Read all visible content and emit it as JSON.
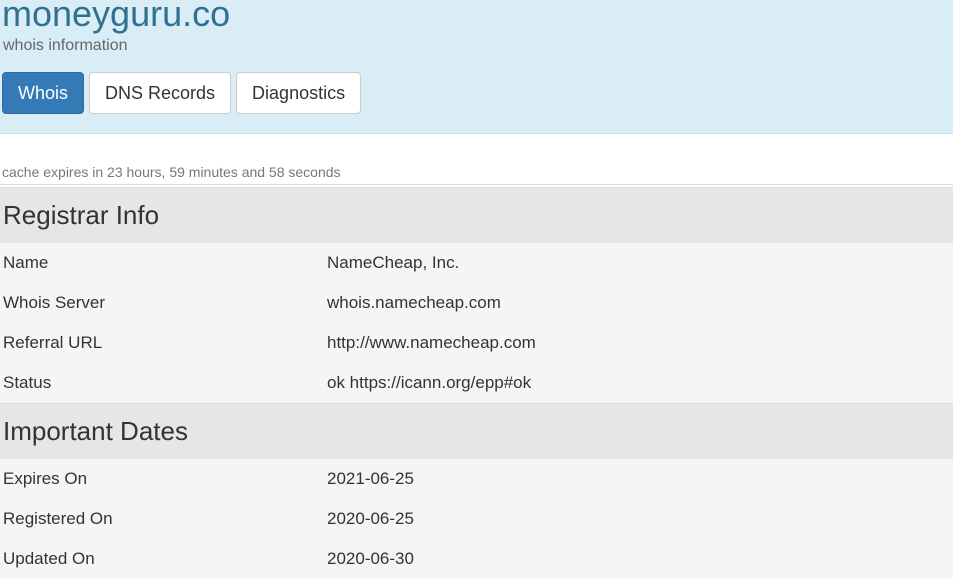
{
  "header": {
    "domain": "moneyguru.co",
    "subtitle": "whois information",
    "tabs": [
      {
        "label": "Whois",
        "active": true
      },
      {
        "label": "DNS Records",
        "active": false
      },
      {
        "label": "Diagnostics",
        "active": false
      }
    ]
  },
  "cache_note": "cache expires in 23 hours, 59 minutes and 58 seconds",
  "registrar": {
    "title": "Registrar Info",
    "rows": [
      {
        "label": "Name",
        "value": "NameCheap, Inc."
      },
      {
        "label": "Whois Server",
        "value": "whois.namecheap.com"
      },
      {
        "label": "Referral URL",
        "value": "http://www.namecheap.com"
      },
      {
        "label": "Status",
        "value": "ok https://icann.org/epp#ok"
      }
    ]
  },
  "dates": {
    "title": "Important Dates",
    "rows": [
      {
        "label": "Expires On",
        "value": "2021-06-25"
      },
      {
        "label": "Registered On",
        "value": "2020-06-25"
      },
      {
        "label": "Updated On",
        "value": "2020-06-30"
      }
    ]
  },
  "colors": {
    "header_bg": "#d9edf7",
    "title": "#31708f",
    "active_tab": "#337ab7",
    "section_head_bg": "#e6e6e6",
    "row_bg": "#f5f5f5"
  }
}
